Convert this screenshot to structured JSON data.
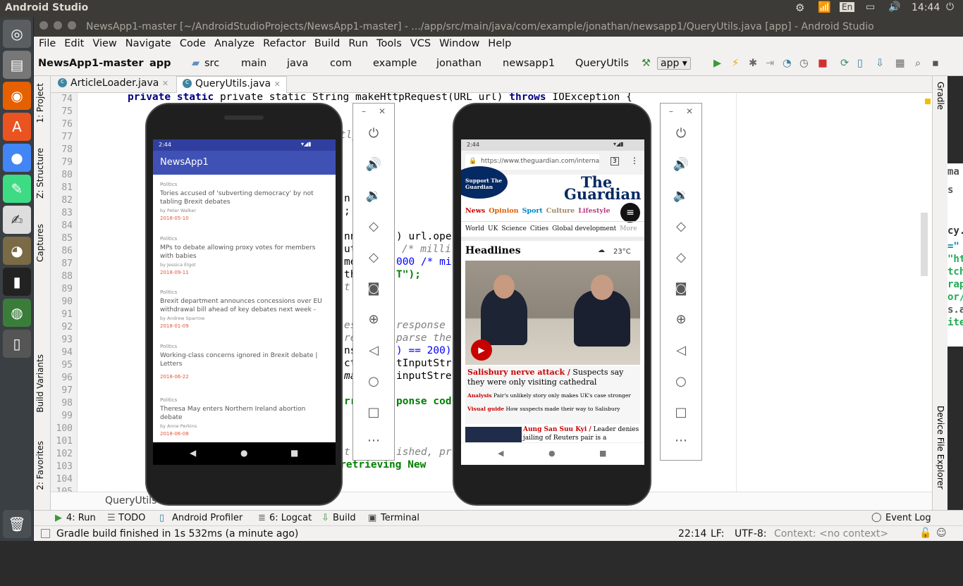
{
  "system": {
    "app_name": "Android Studio",
    "keyboard": "En",
    "time": "14:44"
  },
  "window": {
    "title": "NewsApp1-master [~/AndroidStudioProjects/NewsApp1-master] - .../app/src/main/java/com/example/jonathan/newsapp1/QueryUtils.java [app] - Android Studio"
  },
  "menu": [
    "File",
    "Edit",
    "View",
    "Navigate",
    "Code",
    "Analyze",
    "Refactor",
    "Build",
    "Run",
    "Tools",
    "VCS",
    "Window",
    "Help"
  ],
  "breadcrumbs": [
    "NewsApp1-master",
    "app",
    "src",
    "main",
    "java",
    "com",
    "example",
    "jonathan",
    "newsapp1",
    "QueryUtils"
  ],
  "run_config": "app",
  "tabs": [
    "ArticleLoader.java",
    "QueryUtils.java"
  ],
  "left_tools": [
    "1: Project",
    "Z: Structure",
    "Captures",
    "Build Variants",
    "2: Favorites"
  ],
  "right_tools": {
    "gradle": "Gradle",
    "device_explorer": "Device File Explorer"
  },
  "editor": {
    "line_numbers": [
      "74",
      "75",
      "76",
      "77",
      "78",
      "79",
      "80",
      "81",
      "82",
      "83",
      "84",
      "85",
      "86",
      "87",
      "88",
      "89",
      "90",
      "91",
      "92",
      "93",
      "94",
      "95",
      "96",
      "97",
      "98",
      "99",
      "100",
      "101",
      "102",
      "103",
      "104",
      "105"
    ],
    "code_top": "private static String makeHttpRequest(URL url) throws IOException {",
    "fragments": {
      "f77": "tly.",
      "f82": "n",
      "f82b": ";",
      "f83": ";",
      "f85": "nn",
      "f85b": ") url.ope",
      "f86": "ut",
      "f86b": "/* milli",
      "f87": "me",
      "f87b": "000 /* mi",
      "f88": "th",
      "f88b": "T\");",
      "f89": "t",
      "f92": "es",
      "f92b": "response",
      "f93": "re",
      "f93b": "parse the",
      "f94": "ns",
      "f94b": ") == 200)",
      "f95": "ct",
      "f95b": "tInputStr",
      "f96": "ma",
      "f96b": "inputStre",
      "f98": "rr",
      "f98b": "ponse cod",
      "f102": "t",
      "f102b": "ished, pr",
      "f103": "em retrieving New"
    },
    "breadcrumb_bottom": "QueryUtils",
    "right_panel_fragments": [
      "ma",
      "s",
      "cy.x",
      "=\"",
      "\"ht",
      "tch",
      "rap",
      "or/",
      "s.a",
      "ite"
    ]
  },
  "phone1": {
    "time": "2:44",
    "app_title": "NewsApp1",
    "articles": [
      {
        "section": "Politics",
        "title": "Tories accused of 'subverting democracy' by not tabling Brexit debates",
        "author": "by Peter Walker",
        "date": "2018-05-10"
      },
      {
        "section": "Politics",
        "title": "MPs to debate allowing proxy votes for members with babies",
        "author": "by Jessica Elgot",
        "date": "2018-09-11"
      },
      {
        "section": "Politics",
        "title": "Brexit department announces concessions over EU withdrawal bill ahead of key debates next week -",
        "author": "by Andrew Sparrow",
        "date": "2018-01-09"
      },
      {
        "section": "Politics",
        "title": "Working-class concerns ignored in Brexit debate | Letters",
        "author": "",
        "date": "2018-06-22"
      },
      {
        "section": "Politics",
        "title": "Theresa May enters Northern Ireland abortion debate",
        "author": "by Anne Perkins",
        "date": "2018-06-08"
      }
    ]
  },
  "phone2": {
    "time": "2:44",
    "url": "https://www.theguardian.com/interna",
    "tab_count": "3",
    "support": "Support The Guardian",
    "logo_line1": "The",
    "logo_line2": "Guardian",
    "sections": [
      "News",
      "Opinion",
      "Sport",
      "Culture",
      "Lifestyle"
    ],
    "subnav": [
      "World",
      "UK",
      "Science",
      "Cities",
      "Global development",
      "More"
    ],
    "headlines": "Headlines",
    "weather": "23°C",
    "story1_kicker": "Salisbury nerve attack /",
    "story1": " Suspects say they were only visiting cathedral",
    "story2_kicker": "Analysis",
    "story2": " Pair's unlikely story only makes UK's case stronger",
    "story3_kicker": "Visual guide",
    "story3": " How suspects made their way to Salisbury",
    "story4_kicker": "Aung San Suu Kyi /",
    "story4": " Leader denies jailing of Reuters pair is a"
  },
  "emulator_controls": [
    "power-icon",
    "volume-up-icon",
    "volume-down-icon",
    "rotate-left-icon",
    "rotate-right-icon",
    "camera-icon",
    "zoom-icon",
    "back-icon",
    "home-icon",
    "overview-icon",
    "more-icon"
  ],
  "bottom_tools": [
    "4: Run",
    "TODO",
    "Android Profiler",
    "6: Logcat",
    "Build",
    "Terminal",
    "Event Log"
  ],
  "status": {
    "message": "Gradle build finished in 1s 532ms (a minute ago)",
    "position": "22:14",
    "line_sep": "LF:",
    "encoding": "UTF-8:",
    "context": "Context: <no context>"
  },
  "colors": {
    "keyword": "#000080",
    "comment": "#808080",
    "string": "#008000",
    "number": "#0000ff",
    "appbar": "#3f51b5",
    "guardian_red": "#c70000"
  }
}
